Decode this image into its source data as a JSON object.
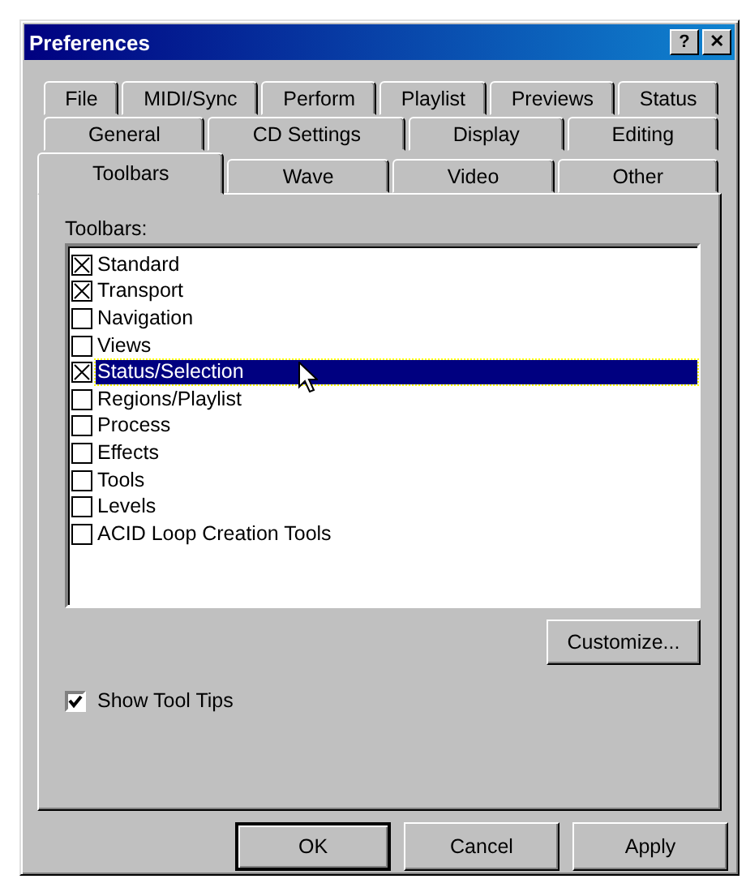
{
  "window": {
    "title": "Preferences",
    "title_buttons": [
      "?",
      "✕"
    ]
  },
  "tab_rows": [
    [
      {
        "label": "File",
        "selected": false
      },
      {
        "label": "MIDI/Sync",
        "selected": false
      },
      {
        "label": "Perform",
        "selected": false
      },
      {
        "label": "Playlist",
        "selected": false
      },
      {
        "label": "Previews",
        "selected": false
      },
      {
        "label": "Status",
        "selected": false
      }
    ],
    [
      {
        "label": "General",
        "selected": false
      },
      {
        "label": "CD Settings",
        "selected": false
      },
      {
        "label": "Display",
        "selected": false
      },
      {
        "label": "Editing",
        "selected": false
      }
    ],
    [
      {
        "label": "Toolbars",
        "selected": true
      },
      {
        "label": "Wave",
        "selected": false
      },
      {
        "label": "Video",
        "selected": false
      },
      {
        "label": "Other",
        "selected": false
      }
    ]
  ],
  "toolbars_label": "Toolbars:",
  "toolbars": [
    {
      "label": "Standard",
      "checked": true,
      "selected": false
    },
    {
      "label": "Transport",
      "checked": true,
      "selected": false
    },
    {
      "label": "Navigation",
      "checked": false,
      "selected": false
    },
    {
      "label": "Views",
      "checked": false,
      "selected": false
    },
    {
      "label": "Status/Selection",
      "checked": true,
      "selected": true
    },
    {
      "label": "Regions/Playlist",
      "checked": false,
      "selected": false
    },
    {
      "label": "Process",
      "checked": false,
      "selected": false
    },
    {
      "label": "Effects",
      "checked": false,
      "selected": false
    },
    {
      "label": "Tools",
      "checked": false,
      "selected": false
    },
    {
      "label": "Levels",
      "checked": false,
      "selected": false
    },
    {
      "label": "ACID Loop Creation Tools",
      "checked": false,
      "selected": false
    }
  ],
  "customize_button": "Customize...",
  "show_tool_tips": {
    "label": "Show Tool Tips",
    "checked": true
  },
  "buttons": [
    "OK",
    "Cancel",
    "Apply"
  ]
}
